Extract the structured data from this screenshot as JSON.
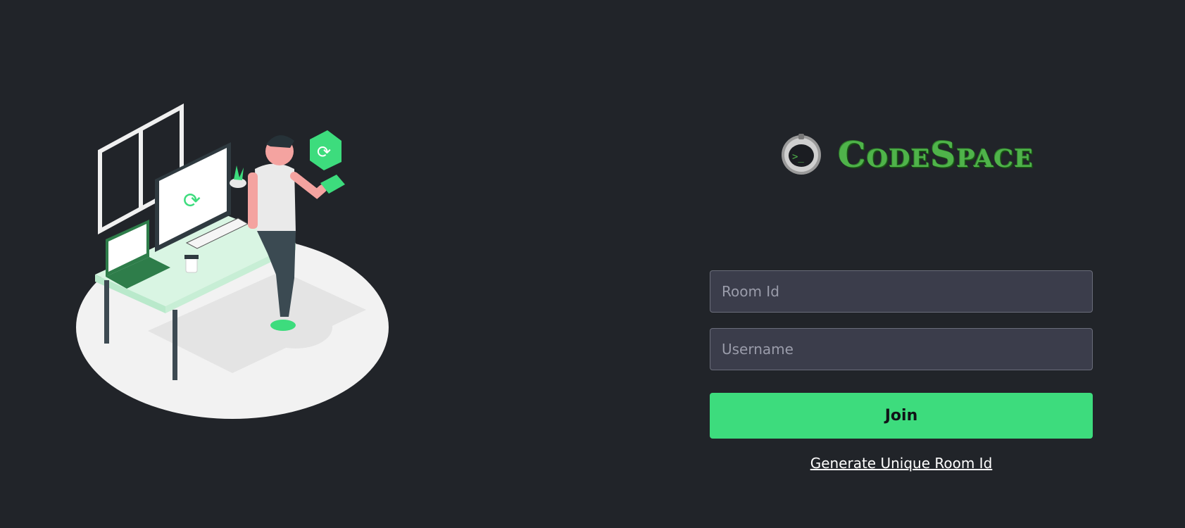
{
  "brand": {
    "name": "CodeSpace",
    "accent": "#4fb34a",
    "logo_icon": "astronaut-helmet-terminal-icon"
  },
  "form": {
    "room_placeholder": "Room Id",
    "username_placeholder": "Username",
    "join_label": "Join",
    "generate_link": "Generate Unique Room Id"
  },
  "colors": {
    "background": "#212429",
    "button": "#3ddc7d",
    "input_bg": "#3b3d4b"
  }
}
